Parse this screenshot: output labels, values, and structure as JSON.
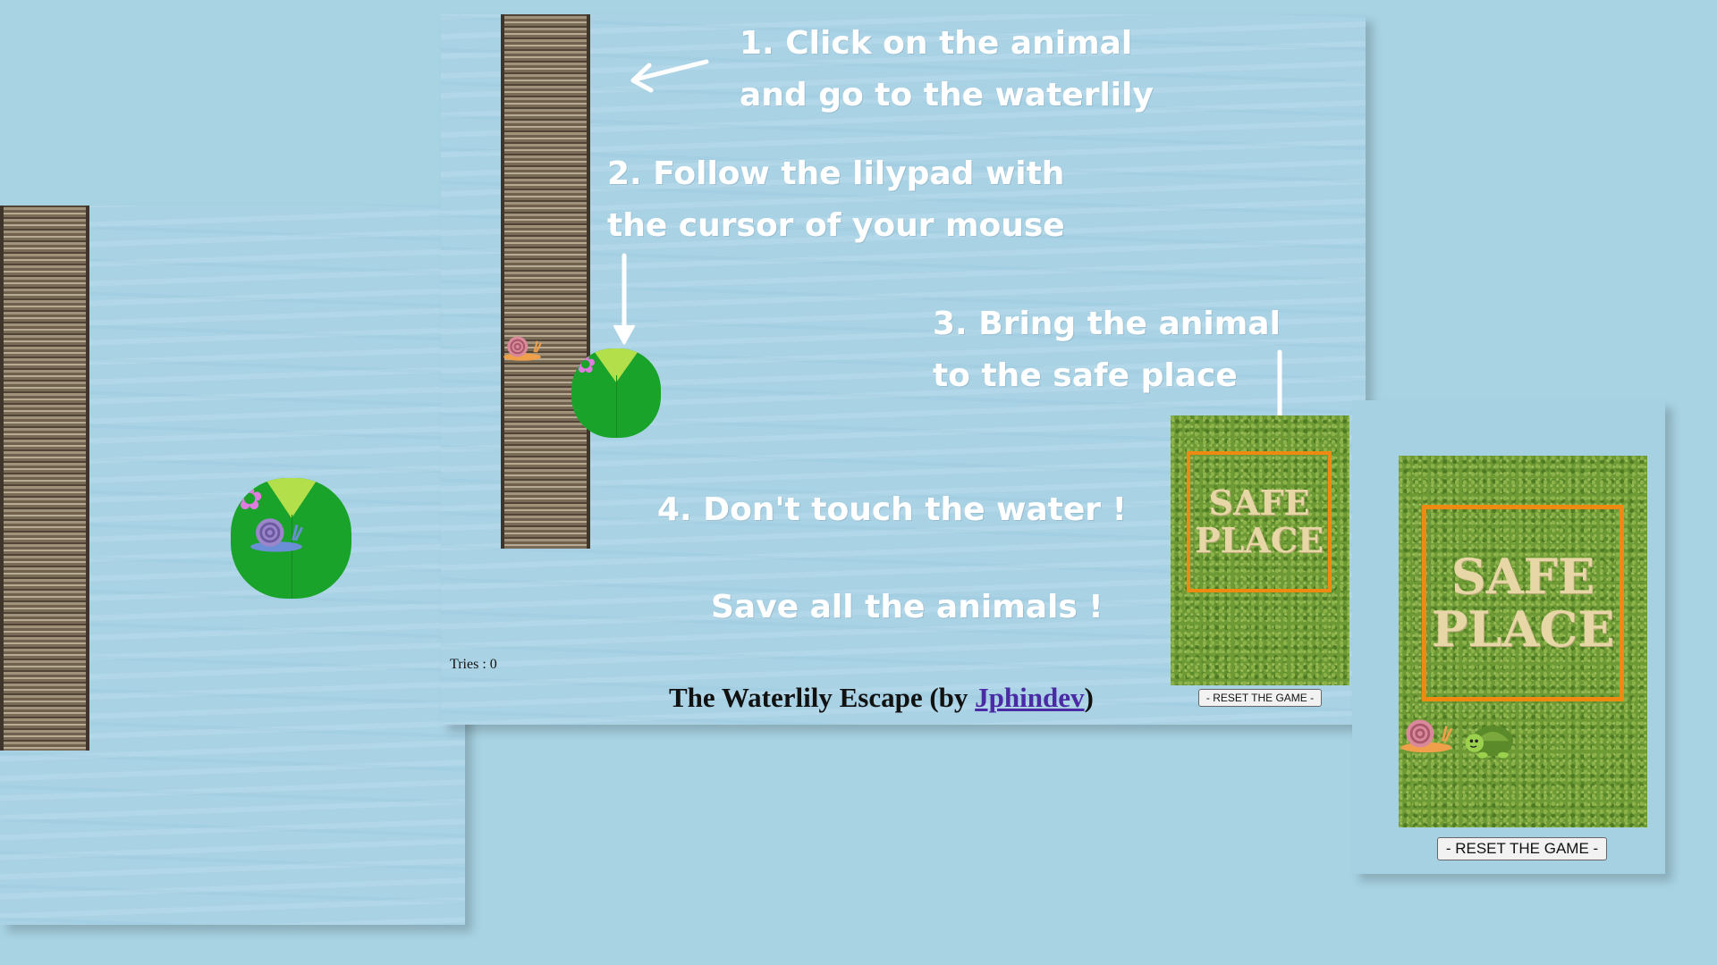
{
  "instructions": {
    "step1": "1. Click on the animal\nand go to the waterlily",
    "step2": "2. Follow the lilypad with\nthe cursor of your mouse",
    "step3": "3. Bring the animal\nto the safe place",
    "step4": "4. Don't touch the water !",
    "goal": "Save all the animals !"
  },
  "safe_place": {
    "label": "SAFE\nPLACE"
  },
  "footer": {
    "tries_label": "Tries : 0",
    "title_prefix": "The Waterlily Escape (by ",
    "author_link": "Jphindev",
    "title_suffix": ")"
  },
  "buttons": {
    "reset_label": "- RESET THE GAME -",
    "reset_label_zoom": "- RESET THE GAME -"
  },
  "colors": {
    "water": "#a9d3e5",
    "lilypad": "#1aa32a",
    "safe_border": "#ee8a12",
    "link": "#4a2aa5"
  },
  "icons": [
    "snail-icon",
    "turtle-icon",
    "flower-icon",
    "lilypad-icon",
    "log-icon",
    "arrow-icon"
  ]
}
